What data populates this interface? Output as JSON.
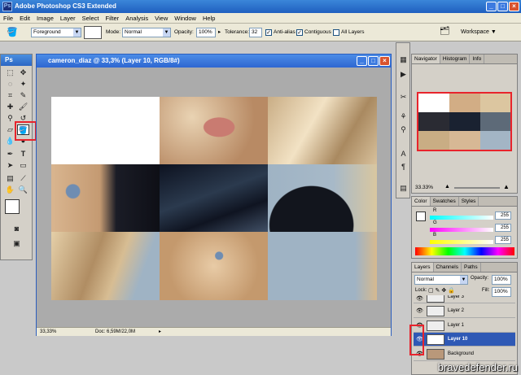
{
  "app": {
    "title": "Adobe Photoshop CS3 Extended",
    "logo": "Ps"
  },
  "menu": [
    "File",
    "Edit",
    "Image",
    "Layer",
    "Select",
    "Filter",
    "Analysis",
    "View",
    "Window",
    "Help"
  ],
  "options": {
    "fill_source": "Foreground",
    "mode_label": "Mode:",
    "mode_value": "Normal",
    "opacity_label": "Opacity:",
    "opacity_value": "100%",
    "tolerance_label": "Tolerance:",
    "tolerance_value": "32",
    "anti_alias": "Anti-alias",
    "contiguous": "Contiguous",
    "all_layers": "All Layers",
    "workspace": "Workspace"
  },
  "document": {
    "title": "cameron_diaz @ 33,3% (Layer 10, RGB/8#)",
    "zoom": "33,33%",
    "doc_info": "Doc: 6,59M/22,0M"
  },
  "navigator": {
    "tabs": [
      "Navigator",
      "Histogram",
      "Info"
    ],
    "zoom": "33.33%"
  },
  "color": {
    "tabs": [
      "Color",
      "Swatches",
      "Styles"
    ],
    "channels": [
      {
        "name": "R",
        "value": "255"
      },
      {
        "name": "G",
        "value": "255"
      },
      {
        "name": "B",
        "value": "255"
      }
    ]
  },
  "layers": {
    "tabs": [
      "Layers",
      "Channels",
      "Paths"
    ],
    "blend": "Normal",
    "opacity_label": "Opacity:",
    "opacity_value": "100%",
    "lock_label": "Lock:",
    "fill_label": "Fill:",
    "fill_value": "100%",
    "items": [
      {
        "name": "Layer 3"
      },
      {
        "name": "Layer 2"
      },
      {
        "name": "Layer 1"
      },
      {
        "name": "Layer 10"
      },
      {
        "name": "Background"
      }
    ]
  },
  "watermark": "bravedefender.ru",
  "colors": {
    "highlight": "#e8242c",
    "title_blue": "#2e66d1",
    "selected_layer": "#2f59b5"
  }
}
